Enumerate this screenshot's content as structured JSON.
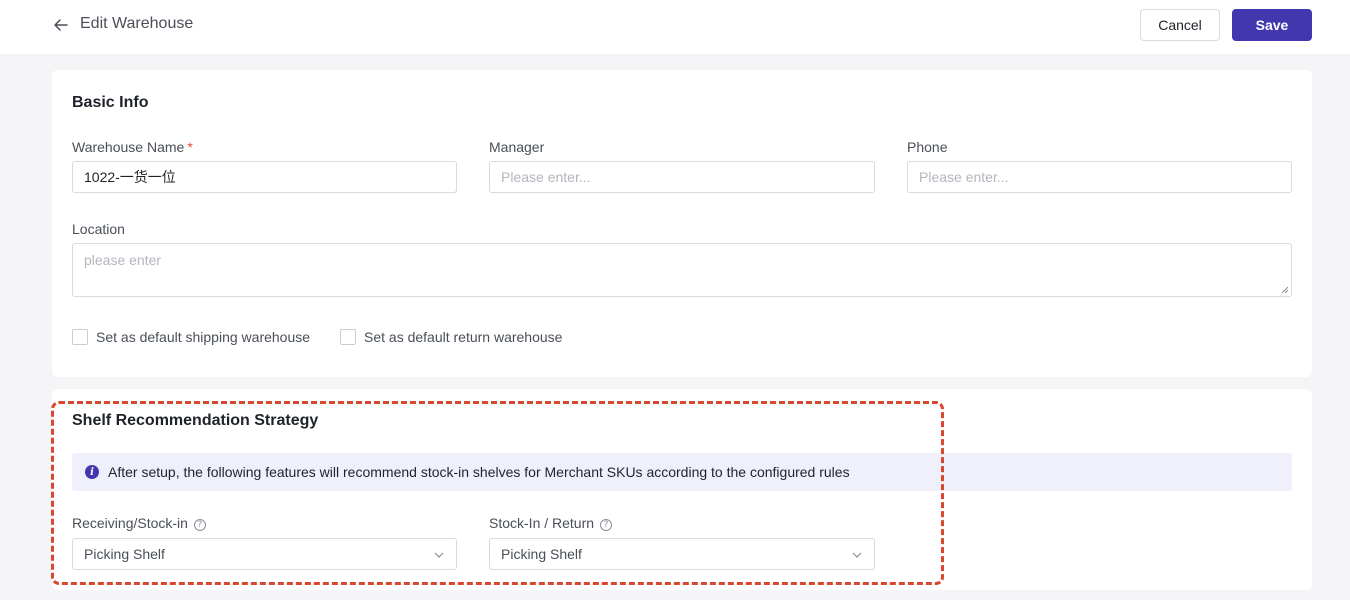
{
  "header": {
    "title": "Edit Warehouse",
    "cancel_label": "Cancel",
    "save_label": "Save"
  },
  "basic_info": {
    "title": "Basic Info",
    "warehouse_name": {
      "label": "Warehouse Name",
      "required_mark": "*",
      "value": "1022-一货一位"
    },
    "manager": {
      "label": "Manager",
      "placeholder": "Please enter..."
    },
    "phone": {
      "label": "Phone",
      "placeholder": "Please enter..."
    },
    "location": {
      "label": "Location",
      "placeholder": "please enter"
    },
    "checkboxes": [
      {
        "label": "Set as default shipping warehouse",
        "checked": false
      },
      {
        "label": "Set as default return warehouse",
        "checked": false
      }
    ]
  },
  "shelf_strategy": {
    "title": "Shelf Recommendation Strategy",
    "info_text": "After setup, the following features will recommend stock-in shelves for Merchant SKUs according to the configured rules",
    "receiving": {
      "label": "Receiving/Stock-in",
      "value": "Picking Shelf"
    },
    "return": {
      "label": "Stock-In / Return",
      "value": "Picking Shelf"
    }
  },
  "colors": {
    "accent": "#4337b0",
    "highlight": "#d9472f",
    "required": "#e34d3b",
    "info_bg": "#eff0fc"
  }
}
